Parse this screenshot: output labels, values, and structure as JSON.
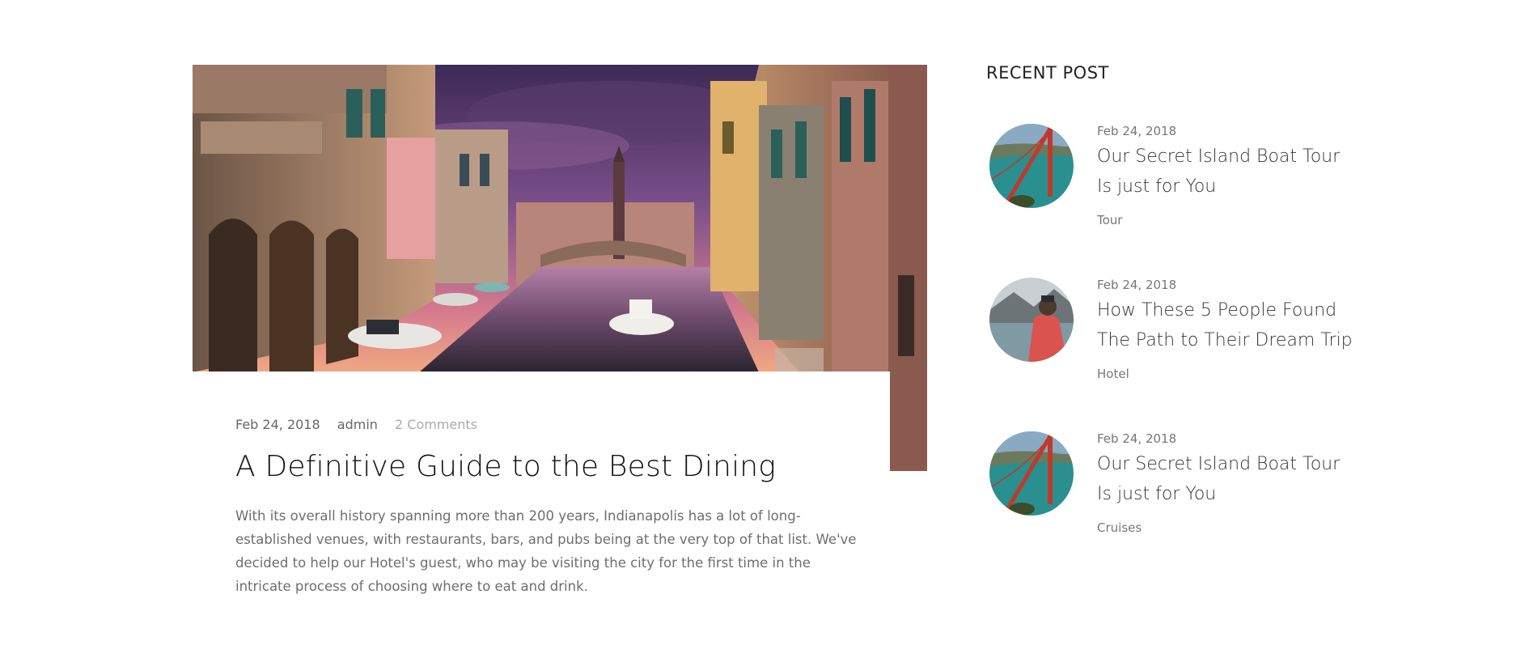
{
  "featured_post": {
    "date": "Feb 24, 2018",
    "author": "admin",
    "comments": "2 Comments",
    "title": "A Definitive Guide to the Best Dining",
    "excerpt": "With its overall history spanning more than 200 years, Indianapolis has a lot of long-established venues, with restaurants, bars, and pubs being at the very top of that list. We've decided to help our Hotel's guest, who may be visiting the city for the first time in the intricate process of choosing where to eat and drink."
  },
  "sidebar": {
    "heading": "RECENT POST",
    "posts": [
      {
        "date": "Feb 24, 2018",
        "title": "Our Secret Island Boat Tour Is just for You",
        "category": "Tour"
      },
      {
        "date": "Feb 24, 2018",
        "title": "How These 5 People Found The Path to Their Dream Trip",
        "category": "Hotel"
      },
      {
        "date": "Feb 24, 2018",
        "title": "Our Secret Island Boat Tour Is just for You",
        "category": "Cruises"
      }
    ]
  }
}
